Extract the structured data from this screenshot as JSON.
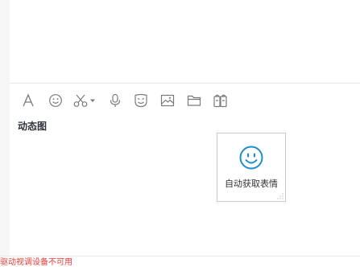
{
  "toolbar": {
    "icons": [
      "font-icon",
      "emoji-icon",
      "scissors-icon",
      "dropdown-arrow-icon",
      "microphone-icon",
      "sticker-icon",
      "image-icon",
      "folder-icon",
      "red-packet-icon"
    ],
    "icon_color": "#7a7a7a"
  },
  "sticker_panel": {
    "tab_label": "动态图",
    "card_label": "自动获取表情",
    "card_icon": "smiley-icon",
    "accent": "#1e90c8"
  },
  "status": {
    "text": "驱动视调设备不可用",
    "color": "#e53935"
  }
}
